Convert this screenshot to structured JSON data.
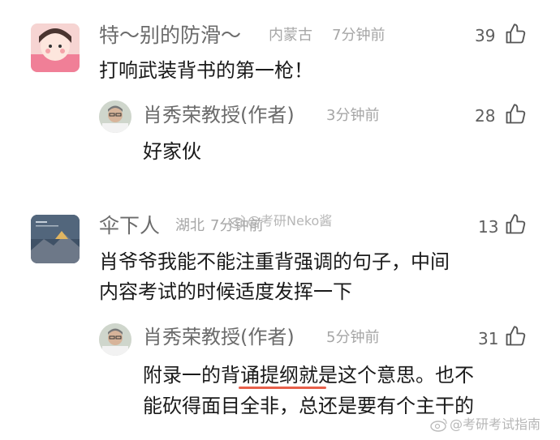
{
  "comments": [
    {
      "user": "特～别的防滑～",
      "location": "内蒙古",
      "time": "7分钟前",
      "likes": "39",
      "text": "打响武装背书的第一枪！",
      "reply": {
        "user": "肖秀荣教授(作者)",
        "time": "3分钟前",
        "likes": "28",
        "text": "好家伙"
      }
    },
    {
      "user": "伞下人",
      "location": "湖北",
      "time": "7分钟前",
      "likes": "13",
      "text_lines": [
        "肖爷爷我能不能注重背强调的句子，中间",
        "内容考试的时候适度发挥一下"
      ],
      "reply": {
        "user": "肖秀荣教授(作者)",
        "time": "5分钟前",
        "likes": "31",
        "line1_before": "附录一的",
        "line1_highlight": "背诵提纲",
        "line1_after": "就是这个意思。也不",
        "line2": "能砍得面目全非，总还是要有个主干的"
      }
    }
  ],
  "watermarks": {
    "middle": "@考研Neko酱",
    "bottom": "@考研考试指南"
  },
  "colors": {
    "username": "#6b6b6b",
    "meta": "#a6a6a6",
    "text": "#1a1a1a",
    "highlight_underline": "#e8604a"
  },
  "icons": [
    "thumbs-up-icon",
    "weibo-icon"
  ]
}
